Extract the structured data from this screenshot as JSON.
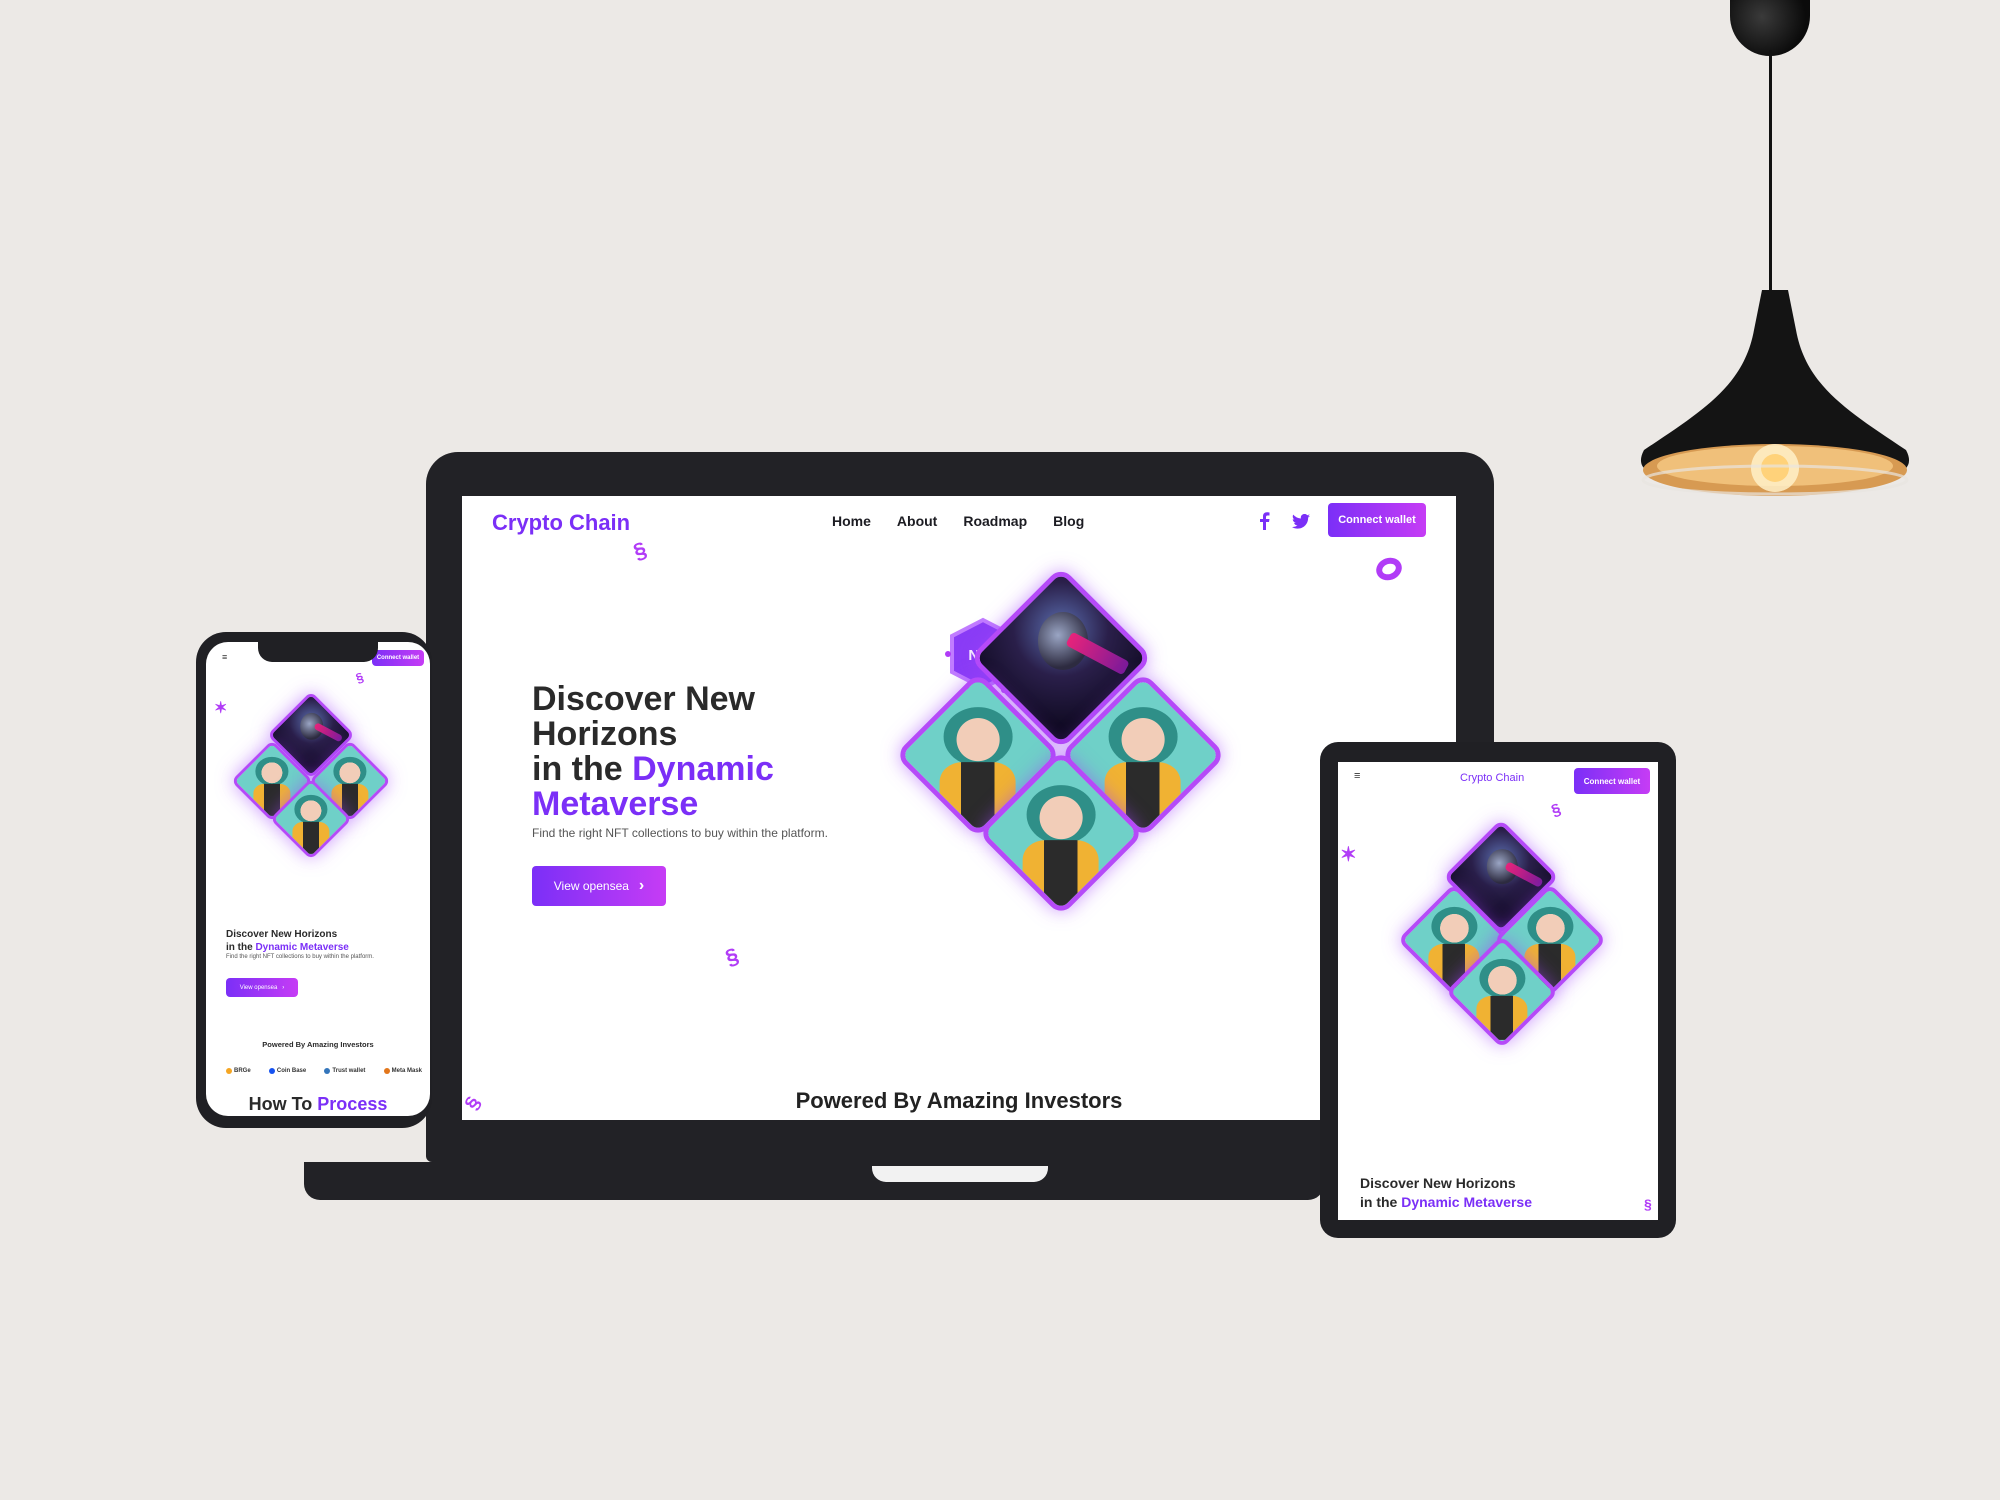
{
  "site": {
    "brand": "Crypto Chain",
    "nav": [
      "Home",
      "About",
      "Roadmap",
      "Blog"
    ],
    "connect_label": "Connect wallet",
    "headline_line1": "Discover New",
    "headline_line2": "Horizons",
    "headline_line3": "in the",
    "headline_accent1": "Dynamic",
    "headline_accent2": "Metaverse",
    "headline_short": "Discover New Horizons",
    "subtitle": "Find the right NFT collections to buy within the platform.",
    "cta_label": "View opensea",
    "investors_title": "Powered By Amazing Investors",
    "process_prefix": "How To",
    "process_accent": "Process",
    "nft_badge": "NFT",
    "investors": [
      "BRGe",
      "Coin Base",
      "Trust wallet",
      "Meta Mask"
    ]
  },
  "colors": {
    "accent": "#7b2ff7",
    "accent2": "#c63cf5",
    "background": "#ece9e6",
    "device": "#222226"
  },
  "icons": [
    "facebook-icon",
    "twitter-icon",
    "chevron-right-icon",
    "hamburger-menu-icon",
    "pendant-lamp"
  ]
}
